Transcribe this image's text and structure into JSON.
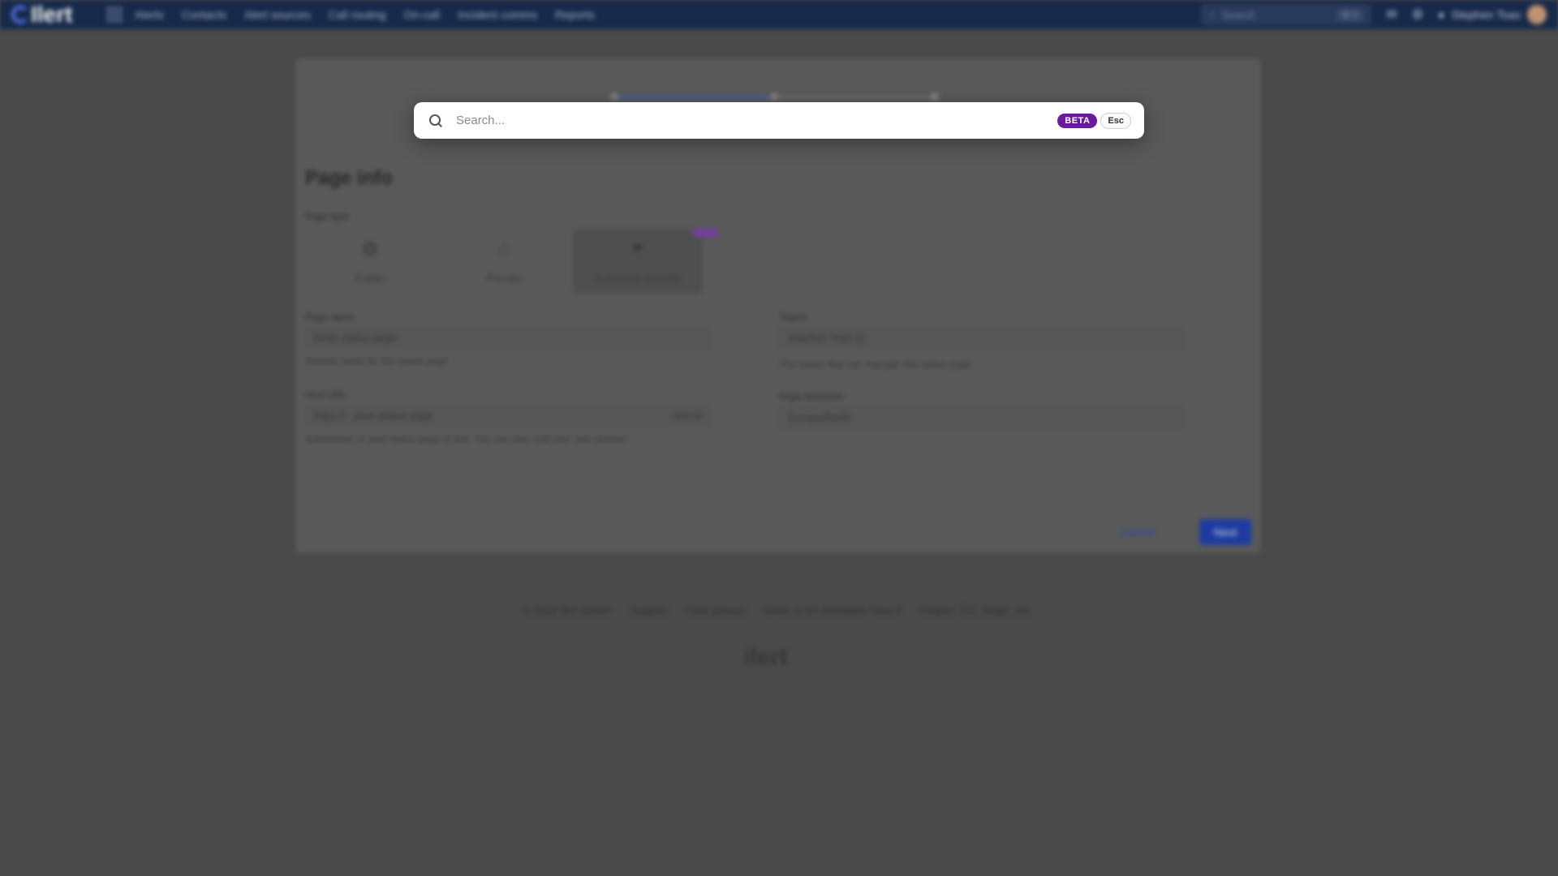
{
  "nav": {
    "logo": "Ilert",
    "items": [
      "Alerts",
      "Contacts",
      "Alert sources",
      "Call routing",
      "On-call",
      "Incident comms",
      "Reports"
    ],
    "search_placeholder": "Search",
    "search_kbd": "⌘ K",
    "user": "Stephen Tsao"
  },
  "page": {
    "title": "Page info",
    "type_label": "Page type",
    "types": [
      "Public",
      "Private",
      "Audience specific"
    ],
    "name_label": "Page name",
    "name_placeholder": "Enter status page",
    "name_hint": "Internal name for the status page",
    "url_label": "Host URL",
    "url_prefix": "https://",
    "url_placeholder": "your-status-page",
    "url_suffix": ".ilert.io",
    "url_hint": "Subdomain of your status page at ilert. You can later add your own domain.",
    "teams_label": "Teams",
    "teams_value": "Stephen Tsao (I)",
    "teams_hint": "The teams that can manage this status page",
    "timezone_label": "Page timezone",
    "timezone_value": "Europe/Berlin",
    "cancel": "Cancel",
    "next": "Next"
  },
  "footer": {
    "links": [
      "© 2024 ilert GmbH",
      "Support",
      "Data privacy",
      "Build: ui-b4-d4fe8d60-74ea-4",
      "Region: EU, Stage: prd"
    ],
    "logo": "ilert"
  },
  "search": {
    "placeholder": "Search...",
    "value": "",
    "beta": "BETA",
    "esc": "Esc"
  }
}
